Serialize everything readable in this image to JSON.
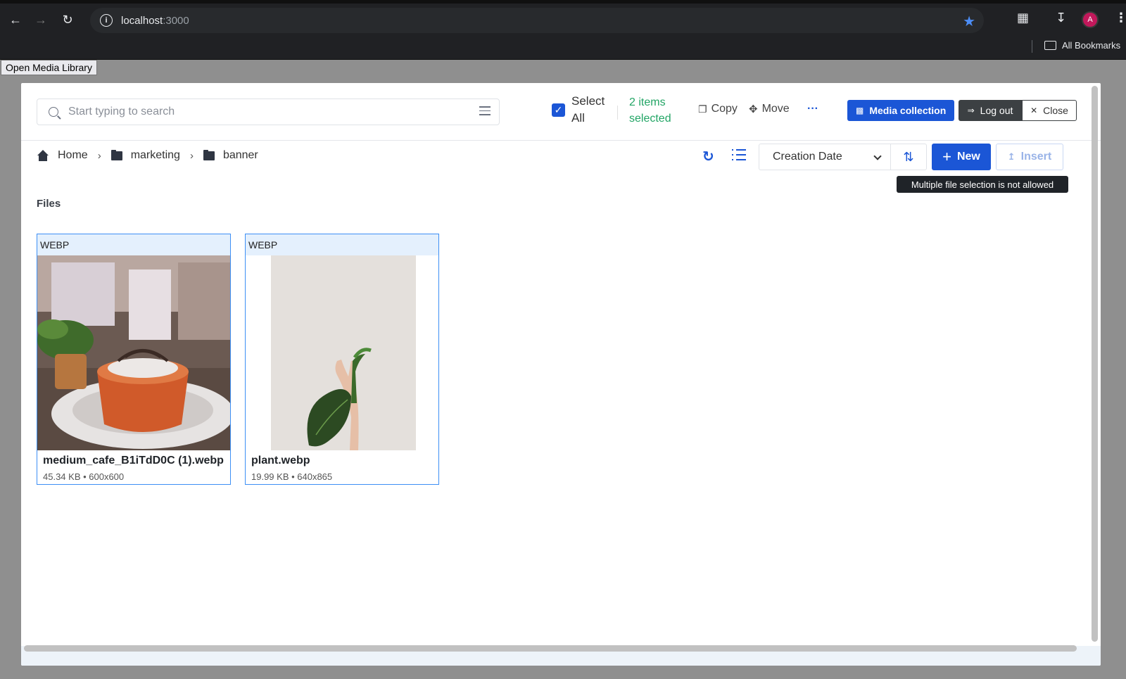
{
  "browser": {
    "host": "localhost",
    "port": ":3000",
    "avatar_letter": "A",
    "bookmarks_label": "All Bookmarks"
  },
  "page": {
    "open_button": "Open Media Library"
  },
  "toolbar": {
    "search_placeholder": "Start typing to search",
    "select_all_label": "Select All",
    "selected_count": "2 items selected",
    "copy_label": "Copy",
    "move_label": "Move",
    "more_label": "···",
    "media_collection_label": "Media collection",
    "logout_label": "Log out",
    "close_label": "Close"
  },
  "breadcrumb": {
    "home": "Home",
    "items": [
      "marketing",
      "banner"
    ]
  },
  "controls": {
    "sort_value": "Creation Date",
    "new_label": "New",
    "insert_label": "Insert",
    "tooltip": "Multiple file selection is not allowed"
  },
  "files": {
    "heading": "Files",
    "items": [
      {
        "type": "WEBP",
        "name": "medium_cafe_B1iTdD0C (1).webp",
        "meta": "45.34 KB • 600x600"
      },
      {
        "type": "WEBP",
        "name": "plant.webp",
        "meta": "19.99 KB • 640x865"
      }
    ]
  },
  "colors": {
    "primary": "#1b56d6",
    "selected_text": "#22a565",
    "card_border": "#3d8ff5",
    "card_header": "#e4f0fd"
  }
}
